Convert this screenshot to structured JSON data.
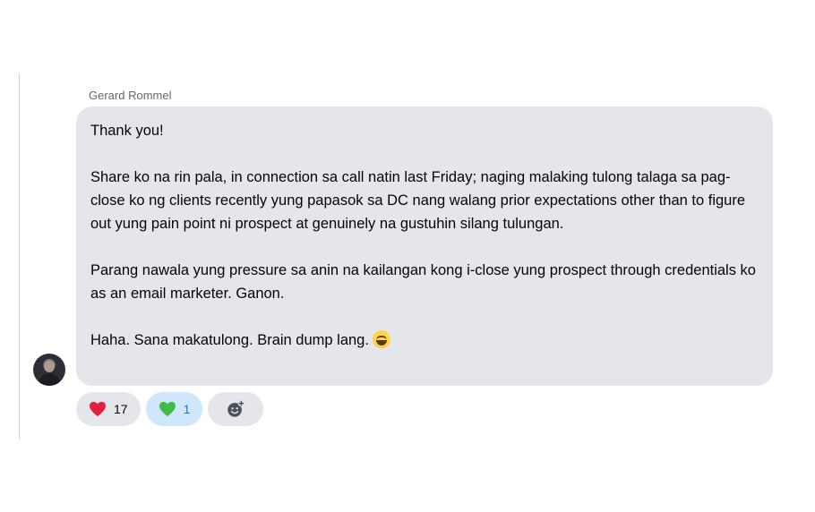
{
  "message": {
    "sender": "Gerard Rommel",
    "lines": [
      "Thank you!",
      "Share ko na rin pala, in connection sa call natin last Friday; naging malaking tulong talaga sa pag-close ko ng clients recently yung papasok sa DC nang walang prior expectations other than to figure out yung pain point ni prospect at genuinely na gustuhin silang tulungan.",
      "Parang nawala yung pressure sa anin na kailangan kong i-close yung prospect through credentials ko as an email marketer. Ganon.",
      "Haha. Sana makatulong. Brain dump lang."
    ],
    "trailing_emoji": "grinning-sweat-emoji"
  },
  "reactions": {
    "red_heart": {
      "icon": "red-heart-icon",
      "count": "17",
      "color": "#e41e3f"
    },
    "green_heart": {
      "icon": "green-heart-icon",
      "count": "1",
      "color": "#3fbb46",
      "active": true
    },
    "add": {
      "icon": "add-reaction-icon"
    }
  },
  "colors": {
    "bubble": "#e4e6eb",
    "active_pill": "#cfe6fb",
    "accent": "#1877f2"
  }
}
